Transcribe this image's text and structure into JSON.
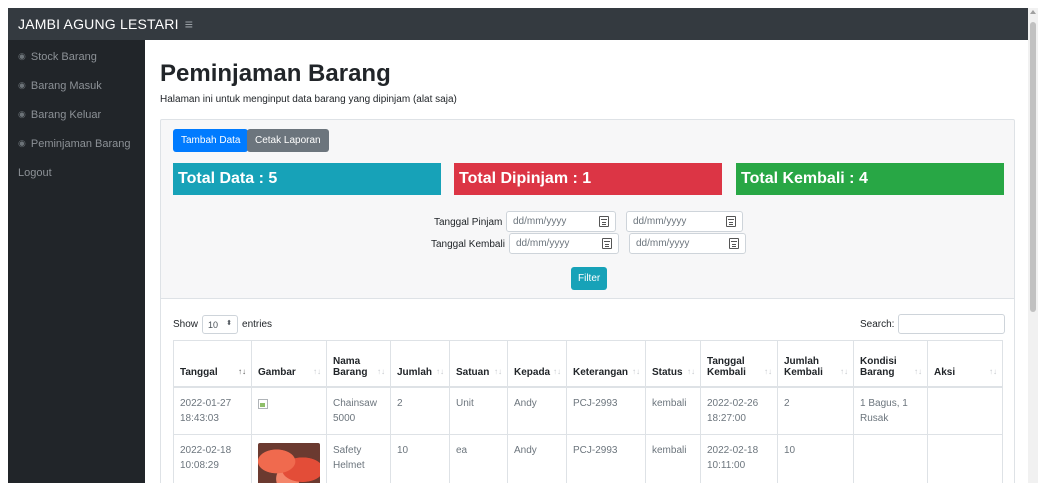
{
  "header": {
    "brand": "JAMBI AGUNG LESTARI",
    "menu_icon": "≡"
  },
  "sidebar": {
    "items": [
      {
        "label": "Stock Barang",
        "icon": "tachometer-icon"
      },
      {
        "label": "Barang Masuk",
        "icon": "tachometer-icon"
      },
      {
        "label": "Barang Keluar",
        "icon": "tachometer-icon"
      },
      {
        "label": "Peminjaman Barang",
        "icon": "tachometer-icon"
      },
      {
        "label": "Logout"
      }
    ]
  },
  "page": {
    "title": "Peminjaman Barang",
    "subtitle": "Halaman ini untuk menginput data barang yang dipinjam (alat saja)"
  },
  "toolbar": {
    "add_label": "Tambah Data",
    "report_label": "Cetak Laporan"
  },
  "stats": {
    "total": "Total Data : 5",
    "borrowed": "Total Dipinjam : 1",
    "returned": "Total Kembali : 4",
    "colors": {
      "total": "#17a2b8",
      "borrowed": "#dc3545",
      "returned": "#28a745"
    }
  },
  "filter": {
    "pinjam_label": "Tanggal Pinjam",
    "kembali_label": "Tanggal Kembali",
    "date_placeholder": "dd/mm/yyyy",
    "button_label": "Filter"
  },
  "table": {
    "show_prefix": "Show",
    "show_value": "10",
    "show_suffix": "entries",
    "search_label": "Search:",
    "columns": [
      "Tanggal",
      "Gambar",
      "Nama Barang",
      "Jumlah",
      "Satuan",
      "Kepada",
      "Keterangan",
      "Status",
      "Tanggal Kembali",
      "Jumlah Kembali",
      "Kondisi Barang",
      "Aksi"
    ],
    "rows": [
      {
        "tanggal": "2022-01-27 18:43:03",
        "gambar": "broken-image-icon",
        "nama": "Chainsaw 5000",
        "jumlah": "2",
        "satuan": "Unit",
        "kepada": "Andy",
        "keterangan": "PCJ-2993",
        "status": "kembali",
        "tgl_kembali": "2022-02-26 18:27:00",
        "jml_kembali": "2",
        "kondisi": "1 Bagus, 1 Rusak",
        "aksi": ""
      },
      {
        "tanggal": "2022-02-18 10:08:29",
        "gambar": "helmet-photo",
        "nama": "Safety Helmet",
        "jumlah": "10",
        "satuan": "ea",
        "kepada": "Andy",
        "keterangan": "PCJ-2993",
        "status": "kembali",
        "tgl_kembali": "2022-02-18 10:11:00",
        "jml_kembali": "10",
        "kondisi": "",
        "aksi": ""
      }
    ]
  }
}
